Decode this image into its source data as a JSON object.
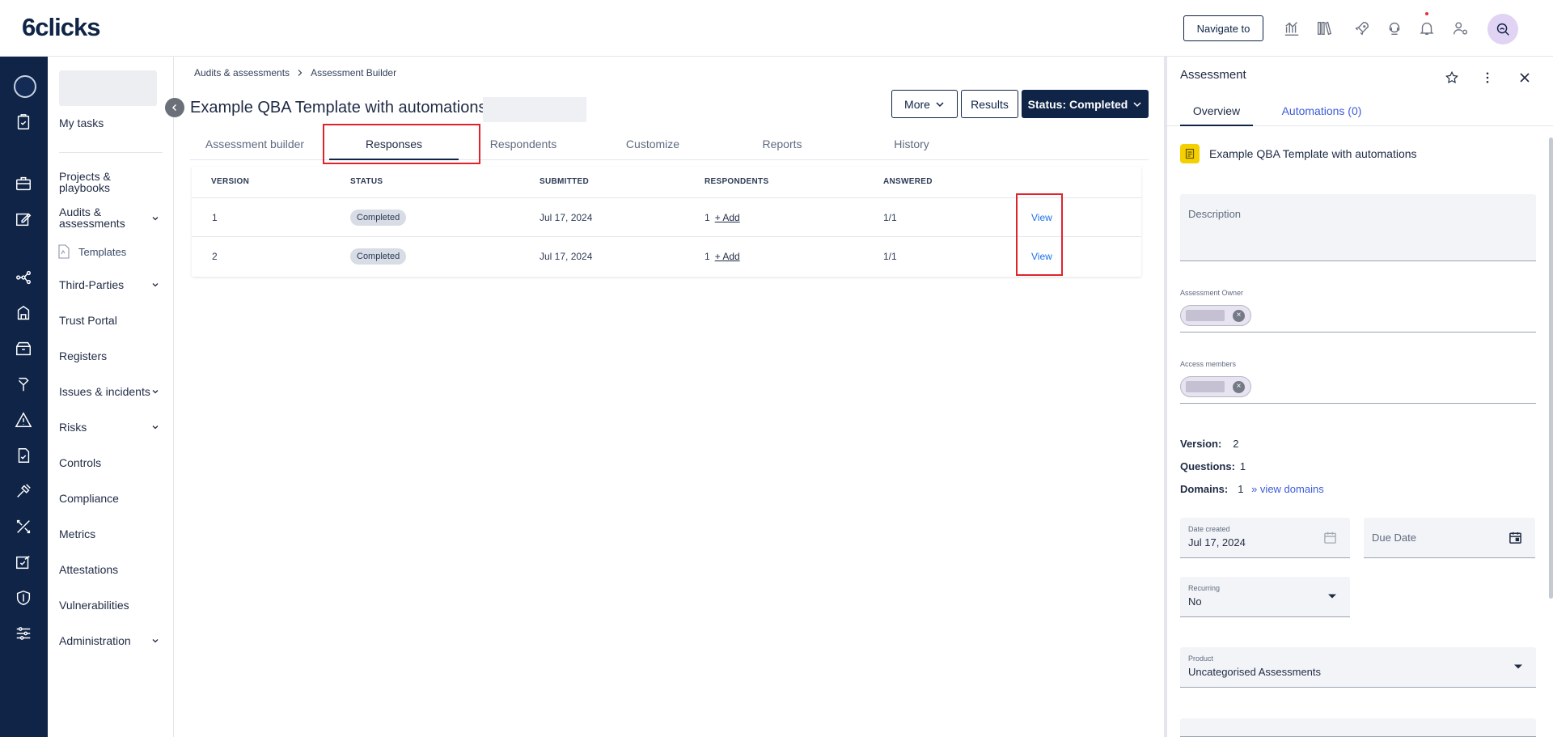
{
  "app": {
    "logo": "6clicks",
    "navigate_label": "Navigate to"
  },
  "nav": {
    "items": [
      {
        "label": "My tasks"
      },
      {
        "label": "Projects & playbooks"
      },
      {
        "label": "Audits & assessments"
      },
      {
        "label": "Templates"
      },
      {
        "label": "Third-Parties"
      },
      {
        "label": "Trust Portal"
      },
      {
        "label": "Registers"
      },
      {
        "label": "Issues & incidents"
      },
      {
        "label": "Risks"
      },
      {
        "label": "Controls"
      },
      {
        "label": "Compliance"
      },
      {
        "label": "Metrics"
      },
      {
        "label": "Attestations"
      },
      {
        "label": "Vulnerabilities"
      },
      {
        "label": "Administration"
      }
    ]
  },
  "breadcrumb": {
    "parent": "Audits & assessments",
    "current": "Assessment Builder"
  },
  "page": {
    "title": "Example QBA Template with automations",
    "more_label": "More",
    "results_label": "Results",
    "status_label": "Status: Completed"
  },
  "tabs": [
    {
      "label": "Assessment builder"
    },
    {
      "label": "Responses"
    },
    {
      "label": "Respondents"
    },
    {
      "label": "Customize"
    },
    {
      "label": "Reports"
    },
    {
      "label": "History"
    }
  ],
  "table": {
    "columns": [
      "VERSION",
      "STATUS",
      "SUBMITTED",
      "RESPONDENTS",
      "ANSWERED"
    ],
    "rows": [
      {
        "version": "1",
        "status": "Completed",
        "submitted": "Jul 17, 2024",
        "respondents": "1",
        "add": "+ Add",
        "answered": "1/1",
        "action": "View"
      },
      {
        "version": "2",
        "status": "Completed",
        "submitted": "Jul 17, 2024",
        "respondents": "1",
        "add": "+ Add",
        "answered": "1/1",
        "action": "View"
      }
    ]
  },
  "panel": {
    "title": "Assessment",
    "tabs": [
      {
        "label": "Overview"
      },
      {
        "label": "Automations (0)"
      }
    ],
    "doc_name": "Example QBA Template with automations",
    "description_label": "Description",
    "owner_label": "Assessment Owner",
    "members_label": "Access members",
    "version_label": "Version:",
    "version_value": "2",
    "questions_label": "Questions:",
    "questions_value": "1",
    "domains_label": "Domains:",
    "domains_value": "1",
    "domains_link": "» view domains",
    "date_created_label": "Date created",
    "date_created_value": "Jul 17, 2024",
    "due_date_label": "Due Date",
    "recurring_label": "Recurring",
    "recurring_value": "No",
    "product_label": "Product",
    "product_value": "Uncategorised Assessments"
  },
  "colors": {
    "navy": "#0f2447",
    "link": "#1a73e8",
    "highlight": "#e0232b",
    "doc_icon": "#f4d000"
  }
}
